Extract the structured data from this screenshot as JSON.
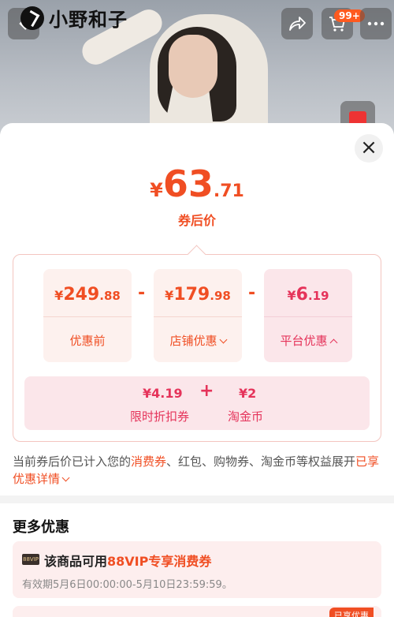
{
  "header": {
    "brand_name": "小野和子",
    "cart_badge": "99+",
    "icons": [
      "back-icon",
      "share-icon",
      "cart-icon",
      "more-icon"
    ]
  },
  "sheet": {
    "price": {
      "currency": "¥",
      "integer": "63",
      "decimal": ".71",
      "caption": "券后价"
    },
    "breakdown": {
      "cards": [
        {
          "currency": "¥",
          "integer": "249",
          "decimal": ".88",
          "label": "优惠前",
          "chevron": ""
        },
        {
          "currency": "¥",
          "integer": "179",
          "decimal": ".98",
          "label": "店铺优惠",
          "chevron": "down"
        },
        {
          "currency": "¥",
          "integer": "6",
          "decimal": ".19",
          "label": "平台优惠",
          "chevron": "up"
        }
      ],
      "operator": "-",
      "platform_details": {
        "value_1": "¥4.19",
        "plus": "+",
        "value_2": "¥2",
        "label_1": "限时折扣券",
        "label_2": "淘金币"
      }
    },
    "note": {
      "part1": "当前券后价已计入您的",
      "highlight": "消费券",
      "part2": "、红包、购物券、淘金币等权益展开",
      "link": "已享优惠详情"
    },
    "more": {
      "title": "更多优惠",
      "offer": {
        "tag": "88VIP",
        "title_prefix": "该商品可用",
        "title_highlight": "88VIP专享消费券",
        "validity": "有效期5月6日00:00:00-5月10日23:59:59。"
      },
      "badge": "已享优惠"
    }
  },
  "colors": {
    "accent": "#f04e23",
    "platform": "#e5335a",
    "card_bg": "#fdf1ee"
  }
}
